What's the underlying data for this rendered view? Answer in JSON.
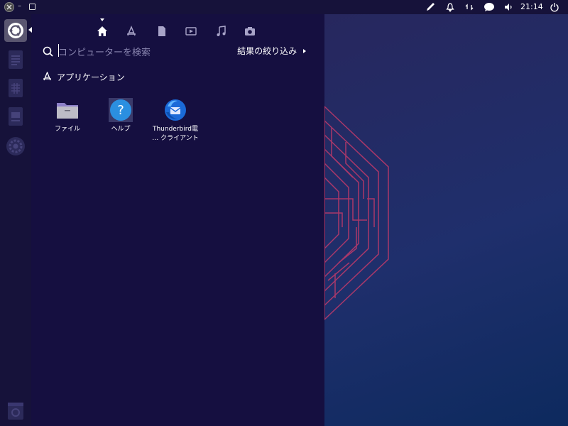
{
  "topbar": {
    "clock": "21:14",
    "tray_icons": [
      "pen-icon",
      "alarm-icon",
      "network-icon",
      "chat-icon",
      "volume-icon",
      "power-icon"
    ]
  },
  "launcher": {
    "items": [
      "ubuntu-logo-icon",
      "document-icon",
      "spreadsheet-icon",
      "presentation-icon",
      "settings-icon",
      "trash-icon"
    ]
  },
  "dash": {
    "lenses": [
      "home-lens-icon",
      "applications-lens-icon",
      "files-lens-icon",
      "video-lens-icon",
      "music-lens-icon",
      "photo-lens-icon"
    ],
    "search_placeholder": "コンピューターを検索",
    "filter_label": "結果の絞り込み",
    "section_title": "アプリケーション",
    "apps": [
      {
        "label": "ファイル",
        "icon": "folder-icon"
      },
      {
        "label": "ヘルプ",
        "icon": "help-icon"
      },
      {
        "label": "Thunderbird電…　クライアント",
        "label_line1": "Thunderbird電",
        "label_line2": "… クライアント",
        "icon": "thunderbird-icon"
      }
    ]
  },
  "colors": {
    "dash_bg": "#150f40",
    "topbar_bg": "#16123a",
    "wallpaper_pattern": "#c23a6a"
  }
}
